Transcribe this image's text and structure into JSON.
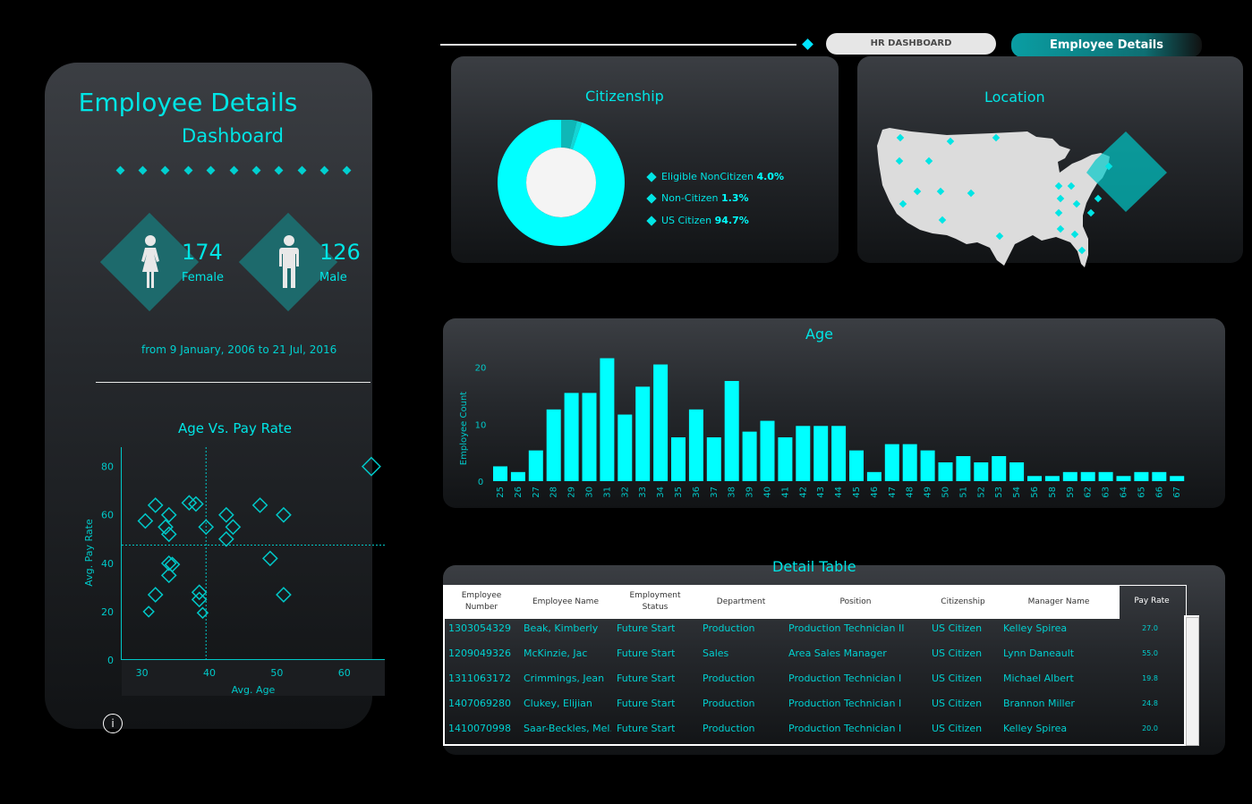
{
  "nav": {
    "hr_button": "HR DASHBOARD",
    "details_button": "Employee Details"
  },
  "left": {
    "title1": "Employee Details",
    "title2": "Dashboard",
    "female_count": "174",
    "female_label": "Female",
    "male_count": "126",
    "male_label": "Male",
    "date_range": "from 9 January, 2006 to 21 Jul, 2016",
    "info_glyph": "i"
  },
  "scatter": {
    "title": "Age Vs. Pay Rate",
    "xlabel": "Avg. Age",
    "ylabel": "Avg. Pay Rate",
    "yticks": [
      "80",
      "60",
      "40",
      "20",
      "0"
    ],
    "xticks": [
      "30",
      "40",
      "50",
      "60"
    ]
  },
  "citizenship": {
    "title": "Citizenship",
    "legend": [
      {
        "label": "Eligible NonCitizen",
        "value": "4.0%"
      },
      {
        "label": "Non-Citizen",
        "value": "1.3%"
      },
      {
        "label": "US Citizen",
        "value": "94.7%"
      }
    ]
  },
  "location": {
    "title": "Location"
  },
  "age": {
    "title": "Age",
    "ylabel": "Employee Count"
  },
  "table": {
    "title": "Detail Table",
    "headers": [
      "Employee Number",
      "Employee Name",
      "Employment Status",
      "Department",
      "Position",
      "Citizenship",
      "Manager Name",
      "Pay Rate"
    ],
    "rows": [
      [
        "1303054329",
        "Beak, Kimberly",
        "Future Start",
        "Production",
        "Production Technician II",
        "US Citizen",
        "Kelley Spirea",
        "27.0"
      ],
      [
        "1209049326",
        "McKinzie, Jac",
        "Future Start",
        "Sales",
        "Area Sales Manager",
        "US Citizen",
        "Lynn Daneault",
        "55.0"
      ],
      [
        "1311063172",
        "Crimmings,   Jean",
        "Future Start",
        "Production",
        "Production Technician I",
        "US Citizen",
        "Michael Albert",
        "19.8"
      ],
      [
        "1407069280",
        "Clukey, Elijian",
        "Future Start",
        "Production",
        "Production Technician I",
        "US Citizen",
        "Brannon Miller",
        "24.8"
      ],
      [
        "1410070998",
        "Saar-Beckles, Mel..",
        "Future Start",
        "Production",
        "Production Technician I",
        "US Citizen",
        "Kelley Spirea",
        "20.0"
      ]
    ]
  },
  "chart_data": [
    {
      "type": "scatter",
      "title": "Age Vs. Pay Rate",
      "xlabel": "Avg. Age",
      "ylabel": "Avg. Pay Rate",
      "xlim": [
        27,
        66
      ],
      "ylim": [
        0,
        88
      ],
      "reference_lines": {
        "x": 39.5,
        "y": 47.5
      },
      "points": [
        [
          30.5,
          57.5
        ],
        [
          32,
          64
        ],
        [
          34,
          60
        ],
        [
          33.5,
          55
        ],
        [
          34,
          52
        ],
        [
          37,
          65
        ],
        [
          38,
          64.5
        ],
        [
          39.5,
          55
        ],
        [
          42.5,
          60
        ],
        [
          43.5,
          55
        ],
        [
          42.5,
          50
        ],
        [
          47.5,
          64
        ],
        [
          51,
          60
        ],
        [
          64,
          80
        ],
        [
          34,
          40
        ],
        [
          34.5,
          39.5
        ],
        [
          34,
          35
        ],
        [
          32,
          27
        ],
        [
          38.5,
          28
        ],
        [
          38.5,
          25
        ],
        [
          31,
          20
        ],
        [
          39,
          19.5
        ],
        [
          49,
          42
        ],
        [
          51,
          27
        ]
      ]
    },
    {
      "type": "pie",
      "title": "Citizenship",
      "labels": [
        "Eligible NonCitizen",
        "Non-Citizen",
        "US Citizen"
      ],
      "values": [
        4.0,
        1.3,
        94.7
      ],
      "colors": [
        "#0fb7b7",
        "#14d4d4",
        "#00ffff"
      ]
    },
    {
      "type": "bar",
      "title": "Age",
      "ylabel": "Employee Count",
      "ylim": [
        0,
        22
      ],
      "yticks": [
        0,
        10,
        20
      ],
      "categories": [
        "25",
        "26",
        "27",
        "28",
        "29",
        "30",
        "31",
        "32",
        "33",
        "34",
        "35",
        "36",
        "37",
        "38",
        "39",
        "40",
        "41",
        "42",
        "43",
        "44",
        "45",
        "46",
        "47",
        "48",
        "49",
        "50",
        "51",
        "52",
        "53",
        "54",
        "56",
        "58",
        "59",
        "62",
        "63",
        "64",
        "65",
        "66",
        "67"
      ],
      "values": [
        2.6,
        1.6,
        5.4,
        12.6,
        15.5,
        15.5,
        21.6,
        11.7,
        16.6,
        20.5,
        7.7,
        12.6,
        7.7,
        17.6,
        8.7,
        10.6,
        7.7,
        9.7,
        9.7,
        9.7,
        5.4,
        1.6,
        6.5,
        6.5,
        5.4,
        3.3,
        4.4,
        3.3,
        4.4,
        3.3,
        0.9,
        0.9,
        1.6,
        1.6,
        1.6,
        0.9,
        1.6,
        1.6,
        0.9
      ],
      "color": "#00ffff"
    }
  ]
}
